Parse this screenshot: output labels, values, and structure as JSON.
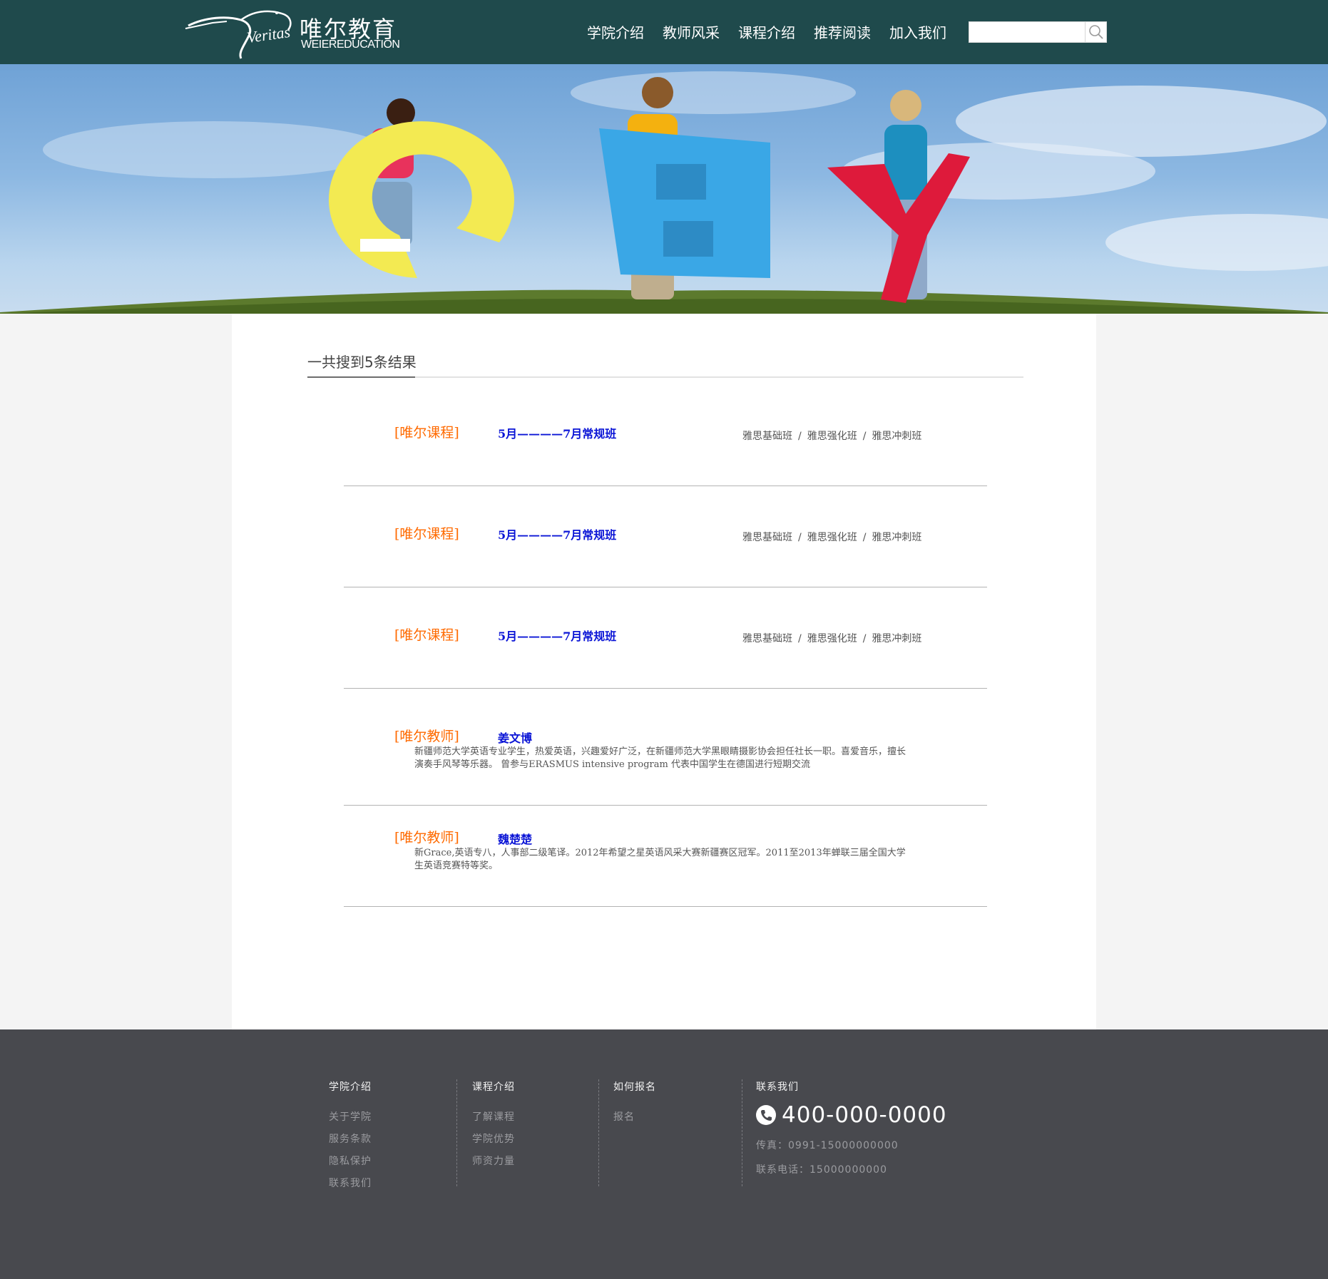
{
  "header": {
    "logo_cn": "唯尔教育",
    "logo_en": "WEIEREDUCATION",
    "logo_script": "Veritas",
    "nav": [
      "学院介绍",
      "教师风采",
      "课程介绍",
      "推荐阅读",
      "加入我们"
    ],
    "search": {
      "value": "",
      "placeholder": ""
    }
  },
  "main": {
    "result_count_text": "一共搜到5条结果",
    "results": [
      {
        "tag": "[唯尔课程]",
        "title": "5月————7月常规班",
        "subs": [
          "雅思基础班",
          "雅思强化班",
          "雅思冲刺班"
        ],
        "sep": "/"
      },
      {
        "tag": "[唯尔课程]",
        "title": "5月————7月常规班",
        "subs": [
          "雅思基础班",
          "雅思强化班",
          "雅思冲刺班"
        ],
        "sep": "/"
      },
      {
        "tag": "[唯尔课程]",
        "title": "5月————7月常规班",
        "subs": [
          "雅思基础班",
          "雅思强化班",
          "雅思冲刺班"
        ],
        "sep": "/"
      },
      {
        "tag": "[唯尔教师]",
        "title": "姜文博",
        "desc": "新疆师范大学英语专业学生，热爱英语，兴趣爱好广泛，在新疆师范大学黑眼睛摄影协会担任社长一职。喜爱音乐，擅长演奏手风琴等乐器。 曾参与ERASMUS intensive program 代表中国学生在德国进行短期交流"
      },
      {
        "tag": "[唯尔教师]",
        "title": "魏楚楚",
        "desc": "新Grace,英语专八，人事部二级笔译。2012年希望之星英语风采大赛新疆赛区冠军。2011至2013年蝉联三届全国大学生英语竞赛特等奖。"
      }
    ]
  },
  "footer": {
    "col1": {
      "title": "学院介绍",
      "links": [
        "关于学院",
        "服务条款",
        "隐私保护",
        "联系我们"
      ]
    },
    "col2": {
      "title": "课程介绍",
      "links": [
        "了解课程",
        "学院优势",
        "师资力量"
      ]
    },
    "col3": {
      "title": "如何报名",
      "links": [
        "报名"
      ]
    },
    "col4": {
      "title": "联系我们",
      "phone": "400-000-0000",
      "fax": "传真：0991-15000000000",
      "tel": "联系电话：15000000000"
    }
  },
  "colors": {
    "header_bg": "#1f4a4c",
    "tag_orange": "#ff6a00",
    "link_blue": "#0a14d6",
    "footer_bg": "#48494e"
  }
}
